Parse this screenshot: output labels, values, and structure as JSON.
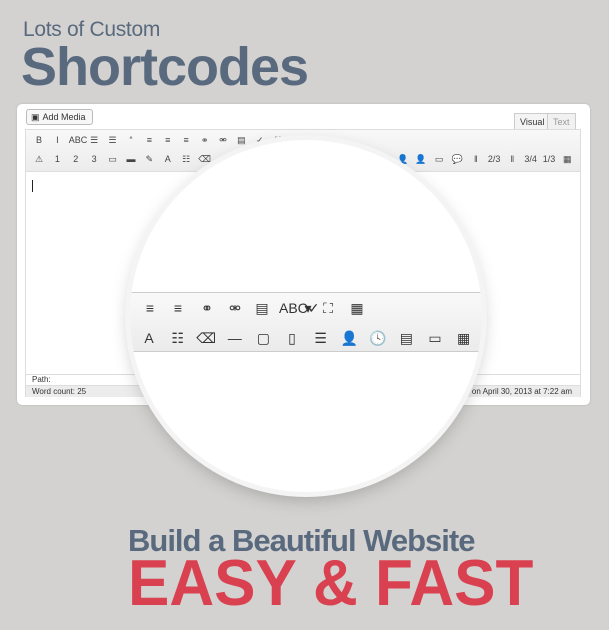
{
  "headline": {
    "line1": "Lots of Custom",
    "line2": "Shortcodes"
  },
  "editor": {
    "add_media": "Add Media",
    "tabs": [
      {
        "label": "Visual",
        "active": true
      },
      {
        "label": "Text",
        "active": false
      }
    ],
    "toolbar_row1": [
      {
        "icon": "bold-icon",
        "glyph": "B"
      },
      {
        "icon": "italic-icon",
        "glyph": "I"
      },
      {
        "icon": "strikethrough-icon",
        "glyph": "ABC"
      },
      {
        "icon": "bullet-list-icon",
        "glyph": "☰"
      },
      {
        "icon": "numbered-list-icon",
        "glyph": "☰"
      },
      {
        "icon": "blockquote-icon",
        "glyph": "“"
      },
      {
        "icon": "align-left-icon",
        "glyph": "≡"
      },
      {
        "icon": "align-center-icon",
        "glyph": "≡"
      },
      {
        "icon": "align-right-icon",
        "glyph": "≡"
      },
      {
        "icon": "link-icon",
        "glyph": "⚭"
      },
      {
        "icon": "unlink-icon",
        "glyph": "⚮"
      },
      {
        "icon": "more-tag-icon",
        "glyph": "▤"
      },
      {
        "icon": "spellcheck-icon",
        "glyph": "✓"
      },
      {
        "icon": "fullscreen-icon",
        "glyph": "⛶"
      },
      {
        "icon": "kitchen-sink-icon",
        "glyph": "▦"
      }
    ],
    "toolbar_row2_left": [
      {
        "icon": "warning-icon",
        "glyph": "⚠"
      },
      {
        "icon": "shortcode-1-icon",
        "glyph": "1"
      },
      {
        "icon": "shortcode-2-icon",
        "glyph": "2"
      },
      {
        "icon": "shortcode-3-icon",
        "glyph": "3"
      },
      {
        "icon": "button-shortcode-icon",
        "glyph": "▭"
      },
      {
        "icon": "black-box-icon",
        "glyph": "▬"
      },
      {
        "icon": "highlight-pencil-icon",
        "glyph": "✎"
      },
      {
        "icon": "text-box-icon",
        "glyph": "A"
      },
      {
        "icon": "list-icon",
        "glyph": "☷"
      },
      {
        "icon": "eraser-icon",
        "glyph": "⌫"
      },
      {
        "icon": "horizontal-rule-icon",
        "glyph": "—"
      },
      {
        "icon": "tabs-icon",
        "glyph": "▢"
      }
    ],
    "toolbar_row2_right": [
      {
        "icon": "panel-icon",
        "glyph": "▣"
      },
      {
        "icon": "frame-icon",
        "glyph": "▢"
      },
      {
        "icon": "team-member-1-icon",
        "glyph": "👤"
      },
      {
        "icon": "team-member-2-icon",
        "glyph": "👤"
      },
      {
        "icon": "progress-bar-icon",
        "glyph": "▭"
      },
      {
        "icon": "tooltip-icon",
        "glyph": "💬"
      },
      {
        "icon": "column-half-icon",
        "glyph": "‖"
      },
      {
        "icon": "column-icon",
        "glyph": "2/3"
      },
      {
        "icon": "column-half-icon",
        "glyph": "‖"
      },
      {
        "icon": "column-icon",
        "glyph": "3/4"
      },
      {
        "icon": "column-icon",
        "glyph": "1/3"
      },
      {
        "icon": "table-grid-icon",
        "glyph": "▦"
      }
    ],
    "path_label": "Path:",
    "word_count": "Word count: 25",
    "last_edited": "min on April 30, 2013 at 7:22 am"
  },
  "magnifier": {
    "row1": [
      {
        "icon": "align-center-icon",
        "glyph": "≡"
      },
      {
        "icon": "align-right-icon",
        "glyph": "≡"
      },
      {
        "icon": "link-icon",
        "glyph": "⚭"
      },
      {
        "icon": "unlink-icon",
        "glyph": "⚮"
      },
      {
        "icon": "more-tag-icon",
        "glyph": "▤"
      },
      {
        "icon": "spellcheck-icon",
        "glyph": "ABC✓"
      },
      {
        "icon": "dropdown-arrow-icon",
        "glyph": "▾"
      },
      {
        "icon": "fullscreen-icon",
        "glyph": "⛶"
      },
      {
        "icon": "kitchen-sink-icon",
        "glyph": "▦"
      }
    ],
    "row2": [
      {
        "icon": "text-box-icon",
        "glyph": "A"
      },
      {
        "icon": "list-icon",
        "glyph": "☷"
      },
      {
        "icon": "eraser-icon",
        "glyph": "⌫"
      },
      {
        "icon": "horizontal-rule-icon",
        "glyph": "—"
      },
      {
        "icon": "tabs-icon",
        "glyph": "▢"
      },
      {
        "icon": "sidebar-box-icon",
        "glyph": "▯"
      },
      {
        "icon": "stacked-boxes-icon",
        "glyph": "☰"
      },
      {
        "icon": "person-icon",
        "glyph": "👤"
      },
      {
        "icon": "scheduled-icon",
        "glyph": "🕓"
      },
      {
        "icon": "documents-icon",
        "glyph": "▤"
      },
      {
        "icon": "progress-bar-icon",
        "glyph": "▭"
      },
      {
        "icon": "pricing-table-icon",
        "glyph": "▦"
      }
    ]
  },
  "tagline": {
    "line1": "Build a Beautiful Website",
    "line2": "EASY & FAST"
  },
  "colors": {
    "background": "#d3d2d0",
    "headline": "#5a6a7e",
    "accent": "#d94150"
  }
}
